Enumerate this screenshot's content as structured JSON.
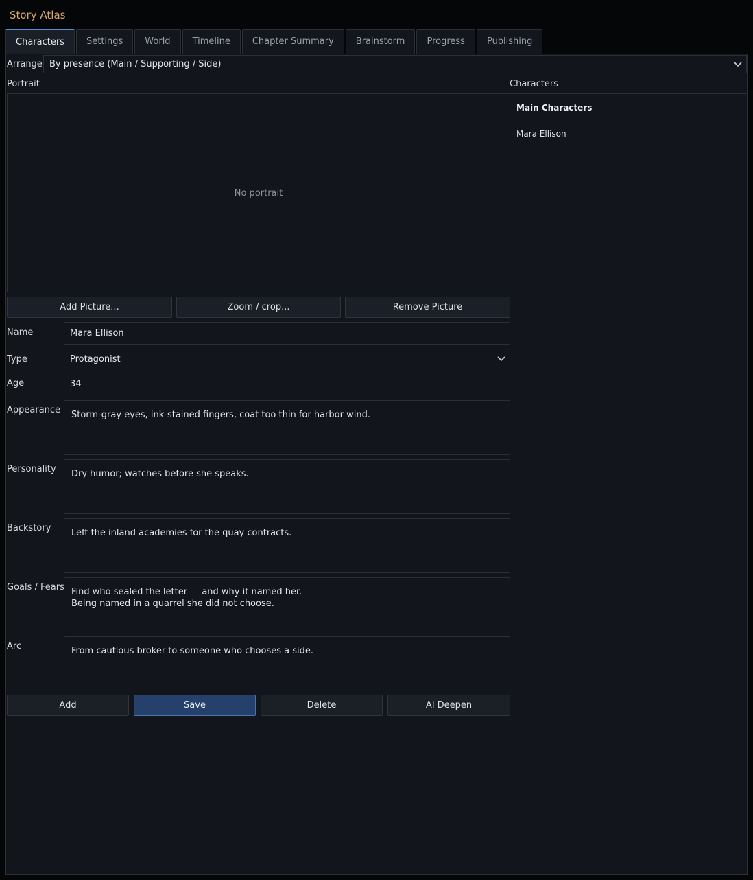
{
  "app": {
    "title": "Story Atlas"
  },
  "tabs": [
    {
      "label": "Characters",
      "active": true
    },
    {
      "label": "Settings"
    },
    {
      "label": "World"
    },
    {
      "label": "Timeline"
    },
    {
      "label": "Chapter Summary"
    },
    {
      "label": "Brainstorm"
    },
    {
      "label": "Progress"
    },
    {
      "label": "Publishing"
    }
  ],
  "arrange": {
    "label": "Arrange",
    "value": "By presence (Main / Supporting / Side)"
  },
  "portrait": {
    "section_label": "Portrait",
    "empty_text": "No portrait",
    "add_label": "Add Picture...",
    "zoom_label": "Zoom / crop...",
    "remove_label": "Remove Picture"
  },
  "form": {
    "name": {
      "label": "Name",
      "value": "Mara Ellison"
    },
    "type": {
      "label": "Type",
      "value": "Protagonist"
    },
    "age": {
      "label": "Age",
      "value": "34"
    },
    "appearance": {
      "label": "Appearance",
      "value": "Storm-gray eyes, ink-stained fingers, coat too thin for harbor wind."
    },
    "personality": {
      "label": "Personality",
      "value": "Dry humor; watches before she speaks."
    },
    "backstory": {
      "label": "Backstory",
      "value": "Left the inland academies for the quay contracts."
    },
    "goals": {
      "label": "Goals / Fears",
      "value": "Find who sealed the letter — and why it named her.\nBeing named in a quarrel she did not choose."
    },
    "arc": {
      "label": "Arc",
      "value": "From cautious broker to someone who chooses a side."
    }
  },
  "actions": {
    "add": "Add",
    "save": "Save",
    "delete": "Delete",
    "ai_deepen": "AI Deepen"
  },
  "characters": {
    "section_label": "Characters",
    "group_heading": "Main Characters",
    "items": [
      "Mara Ellison"
    ]
  },
  "colors": {
    "accent": "#5b8bd6",
    "title": "#d7a56a",
    "background": "#12151c"
  }
}
